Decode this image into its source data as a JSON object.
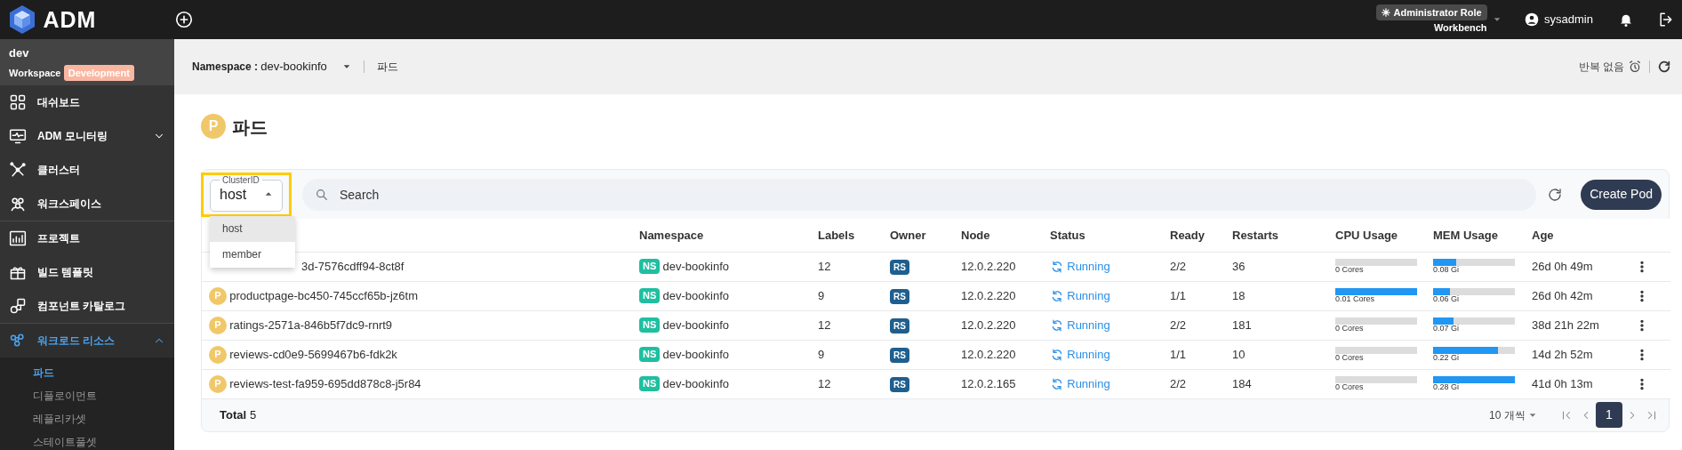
{
  "topbar": {
    "logo": "ADM",
    "role": "Administrator Role",
    "role_sub": "Workbench",
    "user": "sysadmin"
  },
  "workspace": {
    "name": "dev",
    "label": "Workspace",
    "badge": "Development"
  },
  "sidebar": {
    "items": [
      {
        "label": "대쉬보드",
        "kind": "link",
        "selected": false
      },
      {
        "label": "ADM 모니터링",
        "kind": "group",
        "expanded": false,
        "selected": false
      },
      {
        "label": "클러스터",
        "kind": "link",
        "selected": false
      },
      {
        "label": "워크스페이스",
        "kind": "link",
        "selected": false
      },
      {
        "label": "프로젝트",
        "kind": "link",
        "selected": false
      },
      {
        "label": "빌드 템플릿",
        "kind": "link",
        "selected": false
      },
      {
        "label": "컴포넌트 카탈로그",
        "kind": "link",
        "selected": false
      },
      {
        "label": "워크로드 리소스",
        "kind": "group",
        "expanded": true,
        "selected": true,
        "children": [
          {
            "label": "파드",
            "selected": true
          },
          {
            "label": "디플로이먼트",
            "selected": false
          },
          {
            "label": "레플리카셋",
            "selected": false
          },
          {
            "label": "스테이트풀셋",
            "selected": false
          }
        ]
      }
    ]
  },
  "subheader": {
    "namespace_label": "Namespace :",
    "namespace": "dev-bookinfo",
    "breadcrumb": "파드",
    "refresh_label": "반복 없음"
  },
  "page": {
    "badge": "P",
    "title": "파드"
  },
  "toolbar": {
    "cluster_select": {
      "label": "ClusterID",
      "value": "host",
      "open": true,
      "options": [
        {
          "label": "host",
          "selected": true
        },
        {
          "label": "member",
          "selected": false
        }
      ]
    },
    "search": {
      "placeholder": "Search"
    },
    "create_button": "Create Pod"
  },
  "table": {
    "columns": [
      "Namespace",
      "Labels",
      "Owner",
      "Node",
      "Status",
      "Ready",
      "Restarts",
      "CPU Usage",
      "MEM Usage",
      "Age"
    ],
    "rows": [
      {
        "name": "3d-7576cdff94-8ct8f",
        "ns_badge": "NS",
        "namespace": "dev-bookinfo",
        "labels": "12",
        "owner": "RS",
        "node": "12.0.2.220",
        "status": "Running",
        "ready": "2/2",
        "restarts": "36",
        "cpu": {
          "level": 0,
          "reading": "0 Cores"
        },
        "mem": {
          "level": 0.28,
          "reading": "0.08 Gi"
        },
        "age": "26d 0h 49m"
      },
      {
        "name": "productpage-bc450-745ccf65b-jz6tm",
        "pod_badge": "P",
        "ns_badge": "NS",
        "namespace": "dev-bookinfo",
        "labels": "9",
        "owner": "RS",
        "node": "12.0.2.220",
        "status": "Running",
        "ready": "1/1",
        "restarts": "18",
        "cpu": {
          "level": 1,
          "reading": "0.01 Cores"
        },
        "mem": {
          "level": 0.21,
          "reading": "0.06 Gi"
        },
        "age": "26d 0h 42m"
      },
      {
        "name": "ratings-2571a-846b5f7dc9-rnrt9",
        "pod_badge": "P",
        "ns_badge": "NS",
        "namespace": "dev-bookinfo",
        "labels": "12",
        "owner": "RS",
        "node": "12.0.2.220",
        "status": "Running",
        "ready": "2/2",
        "restarts": "181",
        "cpu": {
          "level": 0,
          "reading": "0 Cores"
        },
        "mem": {
          "level": 0.25,
          "reading": "0.07 Gi"
        },
        "age": "38d 21h 22m"
      },
      {
        "name": "reviews-cd0e9-5699467b6-fdk2k",
        "pod_badge": "P",
        "ns_badge": "NS",
        "namespace": "dev-bookinfo",
        "labels": "9",
        "owner": "RS",
        "node": "12.0.2.220",
        "status": "Running",
        "ready": "1/1",
        "restarts": "10",
        "cpu": {
          "level": 0,
          "reading": "0 Cores"
        },
        "mem": {
          "level": 0.79,
          "reading": "0.22 Gi"
        },
        "age": "14d 2h 52m"
      },
      {
        "name": "reviews-test-fa959-695dd878c8-j5r84",
        "pod_badge": "P",
        "ns_badge": "NS",
        "namespace": "dev-bookinfo",
        "labels": "12",
        "owner": "RS",
        "node": "12.0.2.165",
        "status": "Running",
        "ready": "2/2",
        "restarts": "184",
        "cpu": {
          "level": 0,
          "reading": "0 Cores"
        },
        "mem": {
          "level": 1,
          "reading": "0.28 Gi"
        },
        "age": "41d 0h 13m"
      }
    ]
  },
  "footer": {
    "total_label": "Total",
    "total": "5",
    "page_size": "10 개씩",
    "pages": [
      {
        "label": "1",
        "selected": true
      }
    ]
  }
}
